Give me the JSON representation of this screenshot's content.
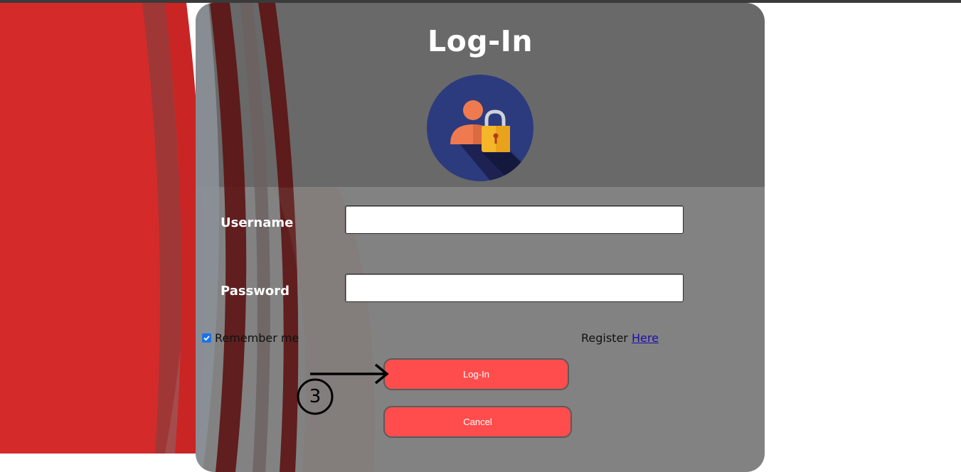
{
  "page": {
    "title": "Log-In",
    "annotation_number": "3"
  },
  "form": {
    "username_label": "Username",
    "password_label": "Password",
    "username_value": "",
    "password_value": "",
    "remember_label": "Remember me",
    "remember_checked": true,
    "register_text": "Register",
    "register_link": "Here",
    "login_button": "Log-In",
    "cancel_button": "Cancel"
  },
  "icons": {
    "avatar": "user-lock-icon",
    "checkbox": "checkmark-icon",
    "arrow": "arrow-right-icon"
  },
  "colors": {
    "background_red": "#d42a2a",
    "button": "#ff4d4d",
    "link": "#1a0dab",
    "avatar_circle": "#2b3b7e",
    "avatar_person": "#f07a4f",
    "lock": "#f5b62a"
  }
}
